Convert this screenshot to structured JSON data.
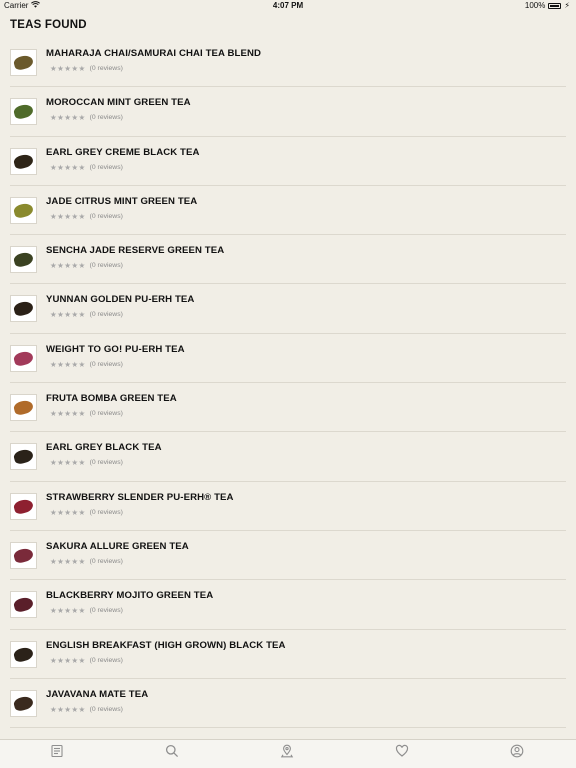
{
  "status_bar": {
    "carrier": "Carrier",
    "time": "4:07 PM",
    "battery": "100%"
  },
  "page": {
    "title": "TEAS FOUND"
  },
  "teas": [
    {
      "name": "MAHARAJA CHAI/SAMURAI CHAI TEA BLEND",
      "stars": "★★★★★",
      "reviews": "(0 reviews)",
      "color": "#6b5a2c"
    },
    {
      "name": "MOROCCAN MINT GREEN TEA",
      "stars": "★★★★★",
      "reviews": "(0 reviews)",
      "color": "#4f6b2a"
    },
    {
      "name": "EARL GREY CREME BLACK TEA",
      "stars": "★★★★★",
      "reviews": "(0 reviews)",
      "color": "#2e2518"
    },
    {
      "name": "JADE CITRUS MINT GREEN TEA",
      "stars": "★★★★★",
      "reviews": "(0 reviews)",
      "color": "#8a8a2e"
    },
    {
      "name": "SENCHA JADE RESERVE GREEN TEA",
      "stars": "★★★★★",
      "reviews": "(0 reviews)",
      "color": "#3b4222"
    },
    {
      "name": "YUNNAN GOLDEN PU-ERH TEA",
      "stars": "★★★★★",
      "reviews": "(0 reviews)",
      "color": "#2b2117"
    },
    {
      "name": "WEIGHT TO GO! PU-ERH TEA",
      "stars": "★★★★★",
      "reviews": "(0 reviews)",
      "color": "#a23a5a"
    },
    {
      "name": "FRUTA BOMBA GREEN TEA",
      "stars": "★★★★★",
      "reviews": "(0 reviews)",
      "color": "#b06b2a"
    },
    {
      "name": "EARL GREY BLACK TEA",
      "stars": "★★★★★",
      "reviews": "(0 reviews)",
      "color": "#2a2219"
    },
    {
      "name": "STRAWBERRY SLENDER PU-ERH® TEA",
      "stars": "★★★★★",
      "reviews": "(0 reviews)",
      "color": "#8e2030"
    },
    {
      "name": "SAKURA ALLURE GREEN TEA",
      "stars": "★★★★★",
      "reviews": "(0 reviews)",
      "color": "#7a2a3a"
    },
    {
      "name": "BLACKBERRY MOJITO GREEN TEA",
      "stars": "★★★★★",
      "reviews": "(0 reviews)",
      "color": "#5a1f2a"
    },
    {
      "name": "ENGLISH BREAKFAST (HIGH GROWN) BLACK TEA",
      "stars": "★★★★★",
      "reviews": "(0 reviews)",
      "color": "#2b2219"
    },
    {
      "name": "JAVAVANA MATE TEA",
      "stars": "★★★★★",
      "reviews": "(0 reviews)",
      "color": "#3a2a1e"
    }
  ],
  "tabs": [
    {
      "icon": "catalog-icon"
    },
    {
      "icon": "search-icon"
    },
    {
      "icon": "store-locator-icon"
    },
    {
      "icon": "heart-icon"
    },
    {
      "icon": "account-icon"
    }
  ],
  "colors": {
    "background": "#f1eee6",
    "tab_icon": "#8f8f8f",
    "star": "#a9a9a9"
  }
}
